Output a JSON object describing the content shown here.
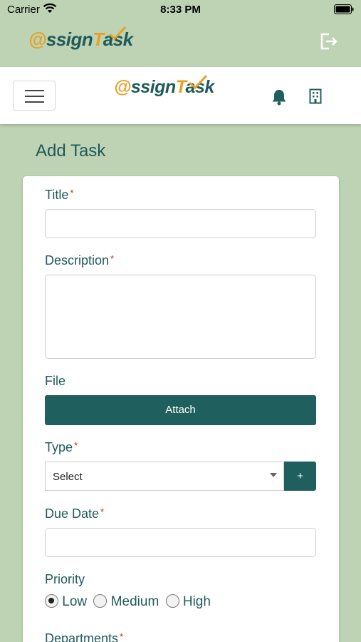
{
  "status_bar": {
    "carrier": "Carrier",
    "time": "8:33 PM"
  },
  "app": {
    "logo_at": "@",
    "logo_ssign": "ssign",
    "logo_T": "T",
    "logo_ask": "ask",
    "logout_icon": "logout-icon",
    "menu_icon": "hamburger-icon",
    "notification_icon": "bell-icon",
    "organization_icon": "building-icon"
  },
  "page": {
    "title": "Add Task"
  },
  "form": {
    "title_label": "Title",
    "title_value": "",
    "description_label": "Description",
    "description_value": "",
    "file_label": "File",
    "attach_label": "Attach",
    "type_label": "Type",
    "type_selected": "Select",
    "add_type_label": "+",
    "due_date_label": "Due Date",
    "due_date_value": "",
    "priority_label": "Priority",
    "priority_options": [
      "Low",
      "Medium",
      "High"
    ],
    "priority_selected": "Low",
    "departments_label": "Departments",
    "required_marker": "*"
  },
  "colors": {
    "background": "#bdd3b4",
    "primary": "#1f5f5d",
    "accent": "#e8a023",
    "required": "#e02020"
  }
}
